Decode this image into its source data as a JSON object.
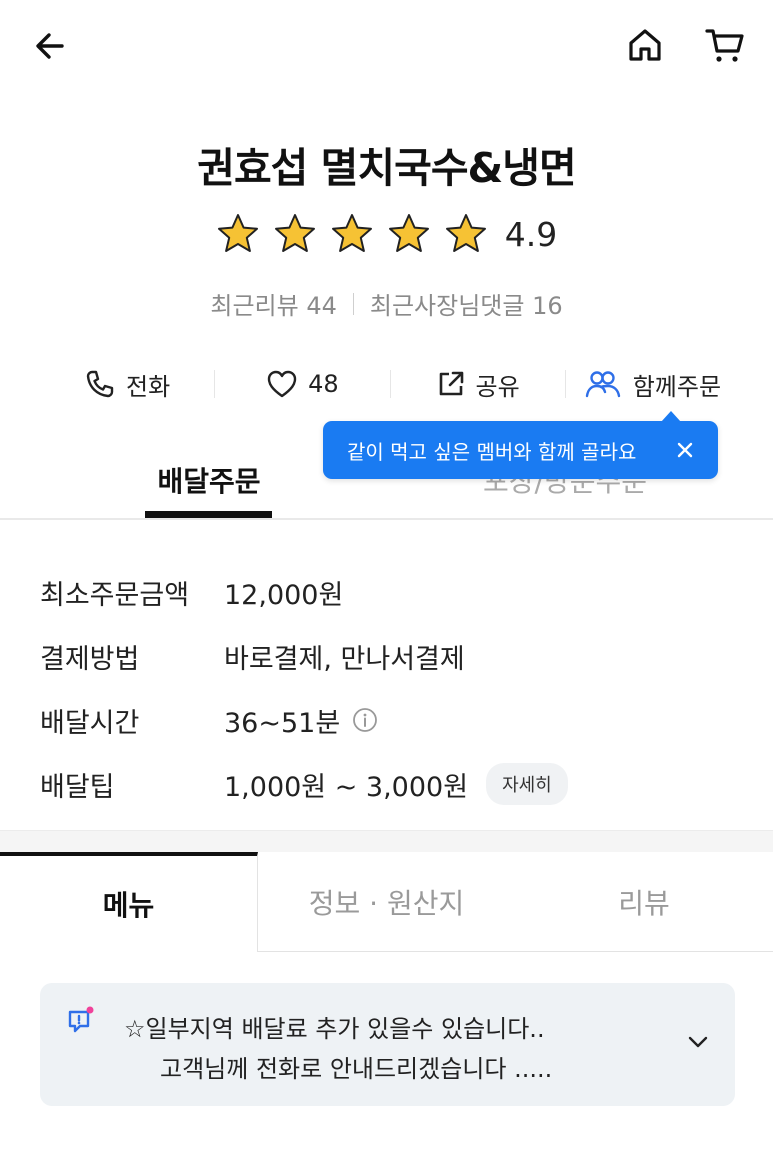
{
  "header": {
    "back_icon": "back-arrow-icon",
    "home_icon": "home-icon",
    "cart_icon": "cart-icon"
  },
  "store": {
    "name": "권효섭 멸치국수&냉면",
    "rating": "4.9",
    "rating_stars": 5,
    "recent_reviews": "최근리뷰 44",
    "owner_replies": "최근사장님댓글 16"
  },
  "actions": {
    "call_label": "전화",
    "like_count": "48",
    "share_label": "공유",
    "group_order_label": "함께주문"
  },
  "tooltip": {
    "text": "같이 먹고 싶은 멤버와 함께 골라요"
  },
  "order_tabs": {
    "delivery": "배달주문",
    "pickup": "포장/방문주문"
  },
  "info": {
    "rows": [
      {
        "label": "최소주문금액",
        "value": "12,000원"
      },
      {
        "label": "결제방법",
        "value": "바로결제, 만나서결제"
      },
      {
        "label": "배달시간",
        "value": "36~51분"
      },
      {
        "label": "배달팁",
        "value": "1,000원 ~ 3,000원"
      }
    ],
    "detail_button": "자세히"
  },
  "content_tabs": {
    "menu": "메뉴",
    "info_origin": "정보 · 원산지",
    "reviews": "리뷰"
  },
  "notice": {
    "line1": "☆일부지역 배달료 추가 있을수 있습니다..",
    "line2": "고객님께 전화로 안내드리겠습니다 ....."
  },
  "colors": {
    "accent_blue": "#1a7bf2",
    "star_yellow": "#f6c234",
    "notice_bg": "#eef2f5"
  }
}
